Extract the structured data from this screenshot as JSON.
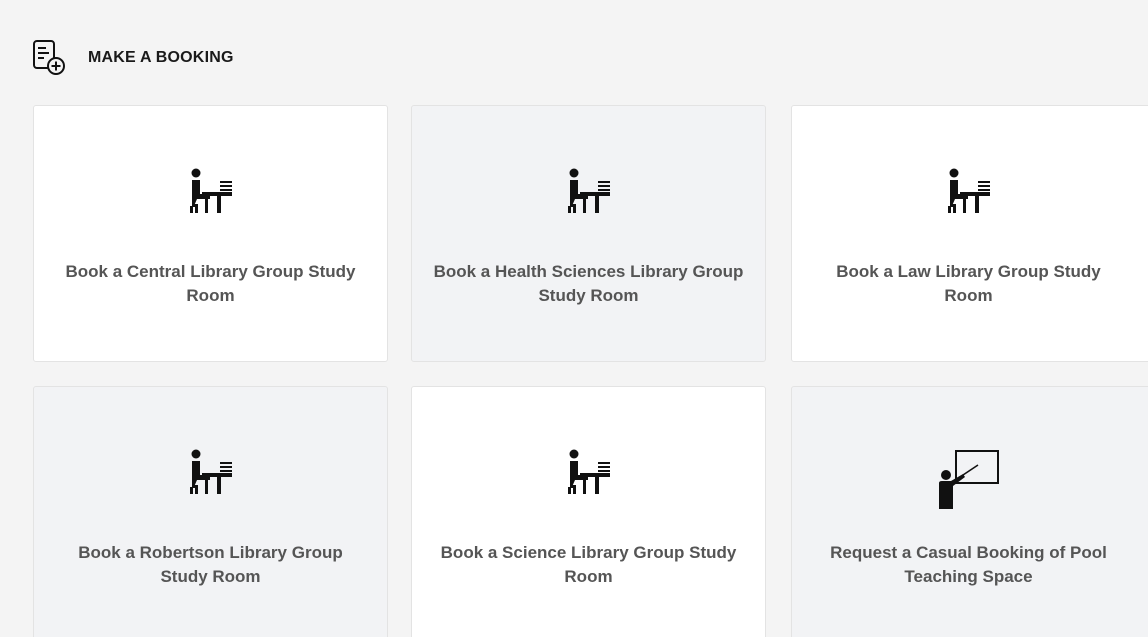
{
  "header": {
    "title": "MAKE A BOOKING",
    "icon": "booking-add-icon"
  },
  "cards": [
    {
      "label": "Book a Central Library Group Study Room",
      "icon": "study-desk-icon"
    },
    {
      "label": "Book a Health Sciences Library Group Study Room",
      "icon": "study-desk-icon"
    },
    {
      "label": "Book a Law Library Group Study Room",
      "icon": "study-desk-icon"
    },
    {
      "label": "Book a Robertson Library Group Study Room",
      "icon": "study-desk-icon"
    },
    {
      "label": "Book a Science Library Group Study Room",
      "icon": "study-desk-icon"
    },
    {
      "label": "Request a Casual Booking of Pool Teaching Space",
      "icon": "teacher-board-icon"
    }
  ],
  "colors": {
    "page_background": "#f4f4f4",
    "card_background": "#ffffff",
    "card_alt_background": "#f2f3f5",
    "label_text": "#555555",
    "icon": "#111111"
  }
}
